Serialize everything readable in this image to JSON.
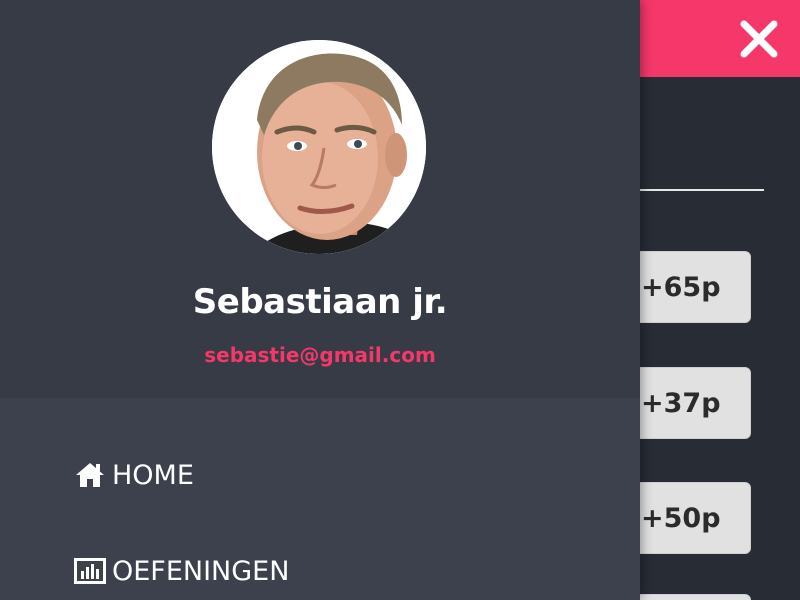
{
  "topbar": {
    "close_icon": "close-icon"
  },
  "profile": {
    "name": "Sebastiaan jr.",
    "email": "sebastie@gmail.com"
  },
  "menu": {
    "items": [
      {
        "label": "HOME",
        "icon": "home-icon"
      },
      {
        "label": "OEFENINGEN",
        "icon": "bar-chart-icon"
      }
    ]
  },
  "scores": {
    "items": [
      {
        "label": "+65p"
      },
      {
        "label": "+37p"
      },
      {
        "label": "+50p"
      }
    ]
  },
  "colors": {
    "accent": "#f5376a",
    "drawer": "#363b46",
    "drawer_menu": "#3c414d",
    "background": "#272c35"
  }
}
